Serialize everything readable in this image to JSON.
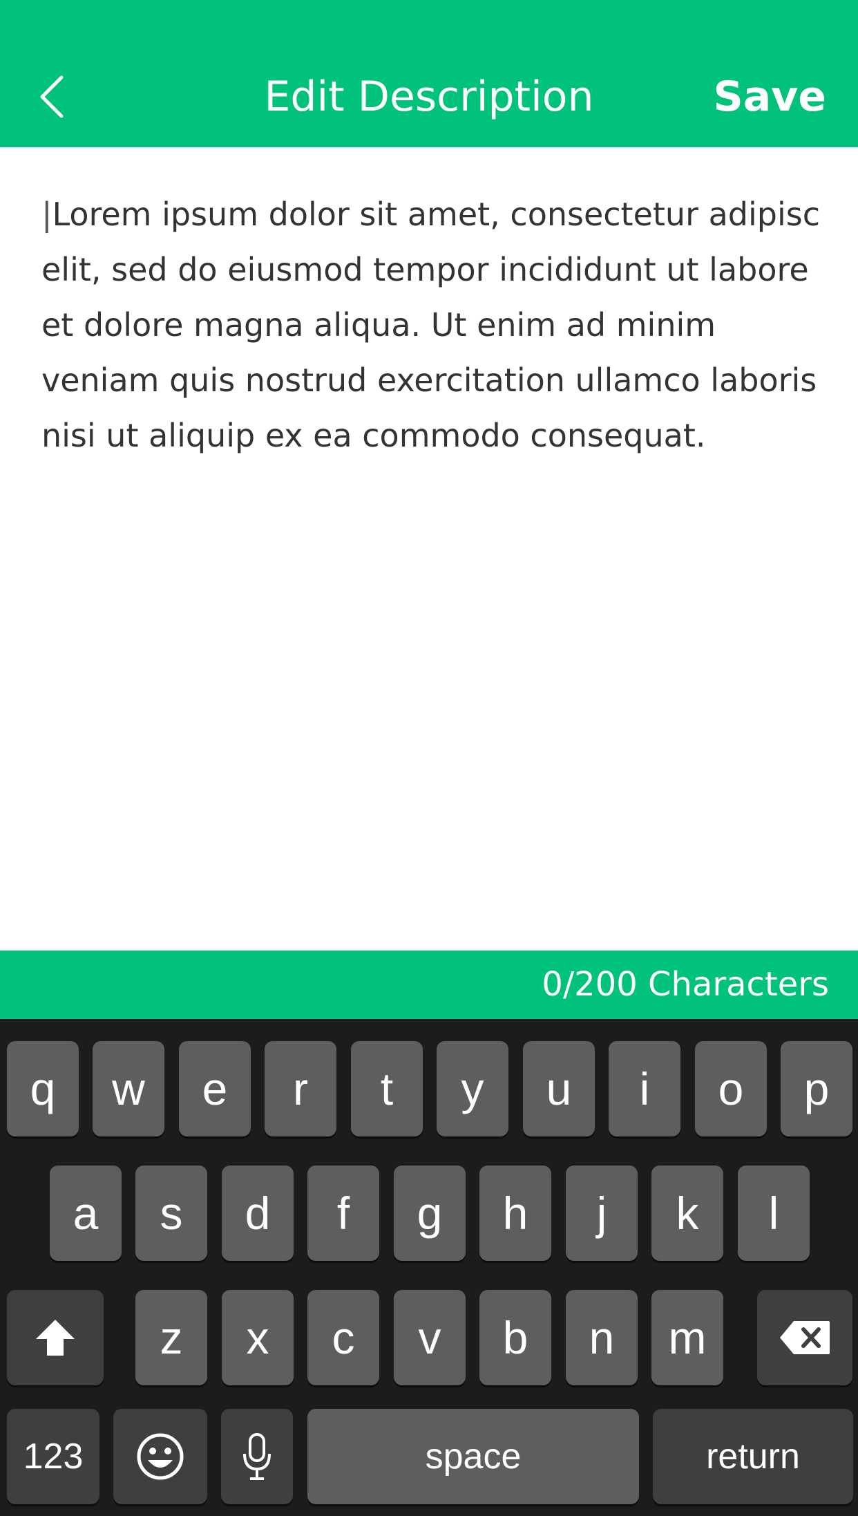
{
  "header": {
    "back_icon": "chevron-left-icon",
    "title": "Edit Description",
    "save_label": "Save"
  },
  "editor": {
    "caret": "|",
    "text": "Lorem ipsum dolor sit amet, consectetur adipisc elit, sed do eiusmod tempor incididunt ut labore et dolore magna aliqua. Ut enim ad minim veniam quis nostrud exercitation ullamco laboris nisi ut aliquip ex ea commodo consequat."
  },
  "counter": {
    "label": "0/200 Characters"
  },
  "keyboard": {
    "row1": [
      "q",
      "w",
      "e",
      "r",
      "t",
      "y",
      "u",
      "i",
      "o",
      "p"
    ],
    "row2": [
      "a",
      "s",
      "d",
      "f",
      "g",
      "h",
      "j",
      "k",
      "l"
    ],
    "row3": [
      "z",
      "x",
      "c",
      "v",
      "b",
      "n",
      "m"
    ],
    "shift_icon": "shift-arrow-icon",
    "delete_icon": "backspace-icon",
    "numbers_label": "123",
    "emoji_icon": "emoji-smiley-icon",
    "mic_icon": "microphone-icon",
    "space_label": "space",
    "return_label": "return"
  },
  "colors": {
    "accent": "#00c27a",
    "keyboard_bg": "#1c1c1c",
    "key_bg": "#5e5e5e",
    "key_dark_bg": "#3f3f3f"
  }
}
